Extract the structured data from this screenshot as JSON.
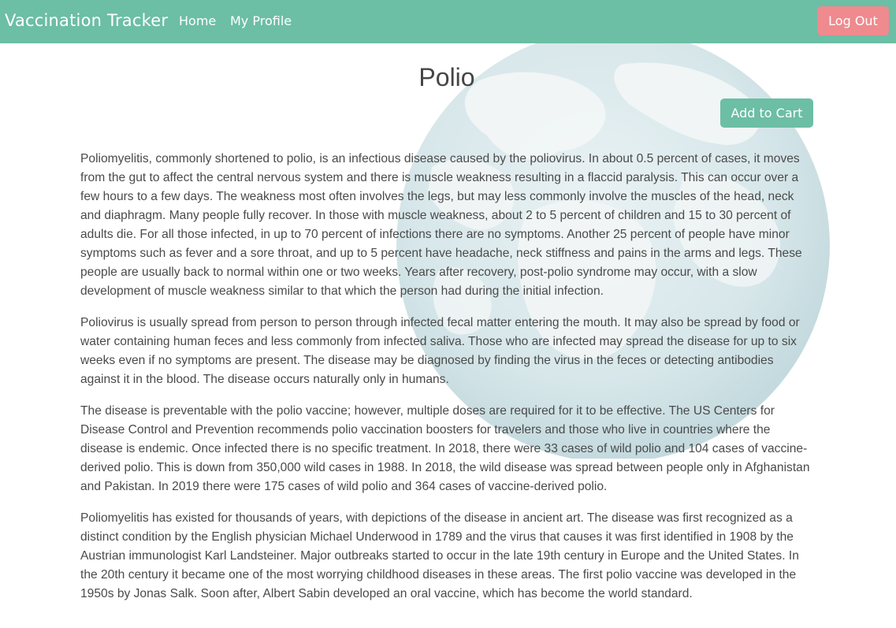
{
  "navbar": {
    "brand": "Vaccination Tracker",
    "links": [
      {
        "label": "Home"
      },
      {
        "label": "My Profile"
      }
    ],
    "logout_label": "Log Out"
  },
  "colors": {
    "primary": "#6cbea4",
    "danger": "#ef8a8e",
    "text": "#4a4a4a"
  },
  "main": {
    "title": "Polio",
    "add_to_cart_label": "Add to Cart",
    "paragraphs": [
      "Poliomyelitis, commonly shortened to polio, is an infectious disease caused by the poliovirus. In about 0.5 percent of cases, it moves from the gut to affect the central nervous system and there is muscle weakness resulting in a flaccid paralysis. This can occur over a few hours to a few days. The weakness most often involves the legs, but may less commonly involve the muscles of the head, neck and diaphragm. Many people fully recover. In those with muscle weakness, about 2 to 5 percent of children and 15 to 30 percent of adults die. For all those infected, in up to 70 percent of infections there are no symptoms. Another 25 percent of people have minor symptoms such as fever and a sore throat, and up to 5 percent have headache, neck stiffness and pains in the arms and legs. These people are usually back to normal within one or two weeks. Years after recovery, post-polio syndrome may occur, with a slow development of muscle weakness similar to that which the person had during the initial infection.",
      "Poliovirus is usually spread from person to person through infected fecal matter entering the mouth. It may also be spread by food or water containing human feces and less commonly from infected saliva. Those who are infected may spread the disease for up to six weeks even if no symptoms are present. The disease may be diagnosed by finding the virus in the feces or detecting antibodies against it in the blood. The disease occurs naturally only in humans.",
      "The disease is preventable with the polio vaccine; however, multiple doses are required for it to be effective. The US Centers for Disease Control and Prevention recommends polio vaccination boosters for travelers and those who live in countries where the disease is endemic. Once infected there is no specific treatment. In 2018, there were 33 cases of wild polio and 104 cases of vaccine-derived polio. This is down from 350,000 wild cases in 1988. In 2018, the wild disease was spread between people only in Afghanistan and Pakistan. In 2019 there were 175 cases of wild polio and 364 cases of vaccine-derived polio.",
      "Poliomyelitis has existed for thousands of years, with depictions of the disease in ancient art. The disease was first recognized as a distinct condition by the English physician Michael Underwood in 1789 and the virus that causes it was first identified in 1908 by the Austrian immunologist Karl Landsteiner. Major outbreaks started to occur in the late 19th century in Europe and the United States. In the 20th century it became one of the most worrying childhood diseases in these areas. The first polio vaccine was developed in the 1950s by Jonas Salk. Soon after, Albert Sabin developed an oral vaccine, which has become the world standard."
    ]
  },
  "background": {
    "icon": "globe-icon"
  }
}
